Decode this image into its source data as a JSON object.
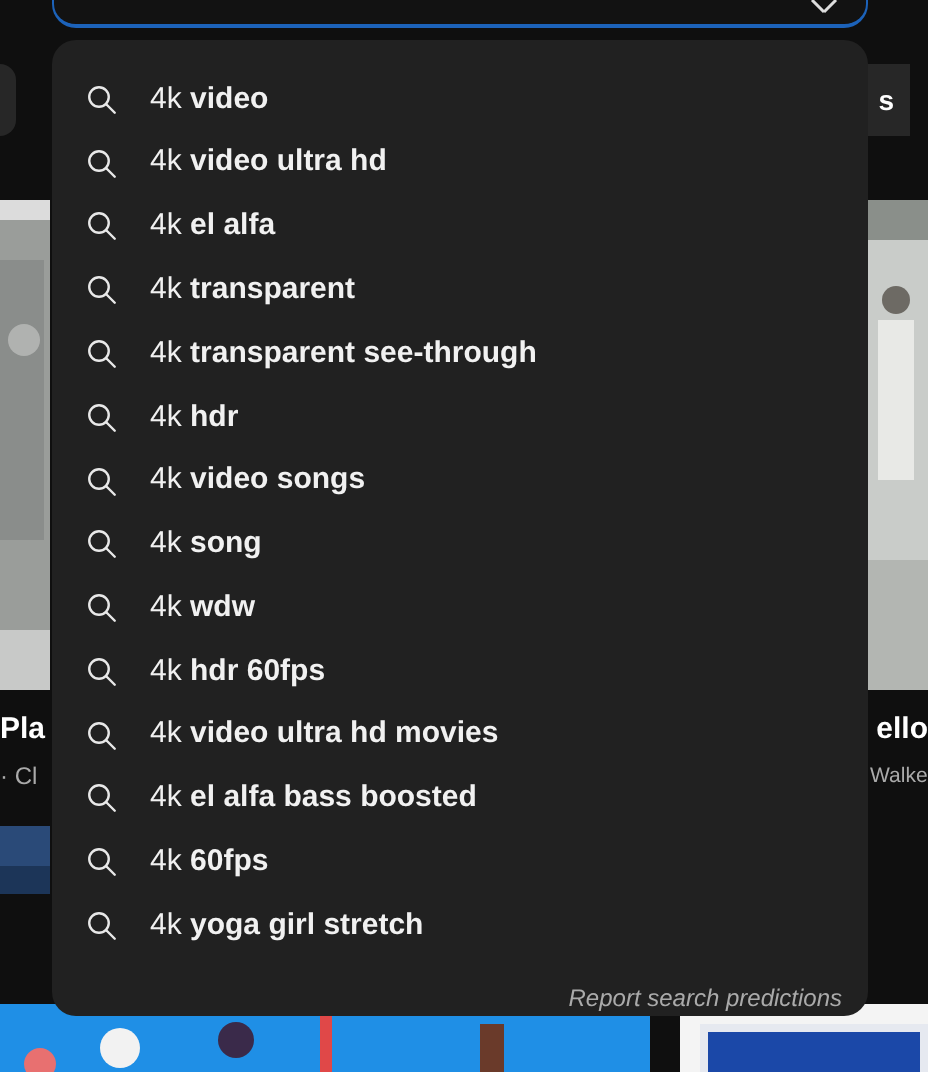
{
  "chips": [
    {
      "label": "s"
    }
  ],
  "videos": [
    {
      "title": "Pla",
      "meta": "· Cl"
    },
    {
      "title": "ello",
      "meta": "Walke"
    }
  ],
  "suggestions": [
    {
      "text": "4k **video**"
    },
    {
      "text": "4k **video ultra hd**"
    },
    {
      "text": "4k **el alfa**"
    },
    {
      "text": "4k **transparent**"
    },
    {
      "text": "4k **transparent see-through**"
    },
    {
      "text": "4k **hdr**"
    },
    {
      "text": "4k **video songs**"
    },
    {
      "text": "4k **song**"
    },
    {
      "text": "4k **wdw**"
    },
    {
      "text": "4k **hdr 60fps**"
    },
    {
      "text": "4k **video ultra hd movies**"
    },
    {
      "text": "4k **el alfa bass boosted**"
    },
    {
      "text": "4k **60fps**"
    },
    {
      "text": "4k **yoga girl stretch**"
    }
  ],
  "report_link": "Report search predictions"
}
